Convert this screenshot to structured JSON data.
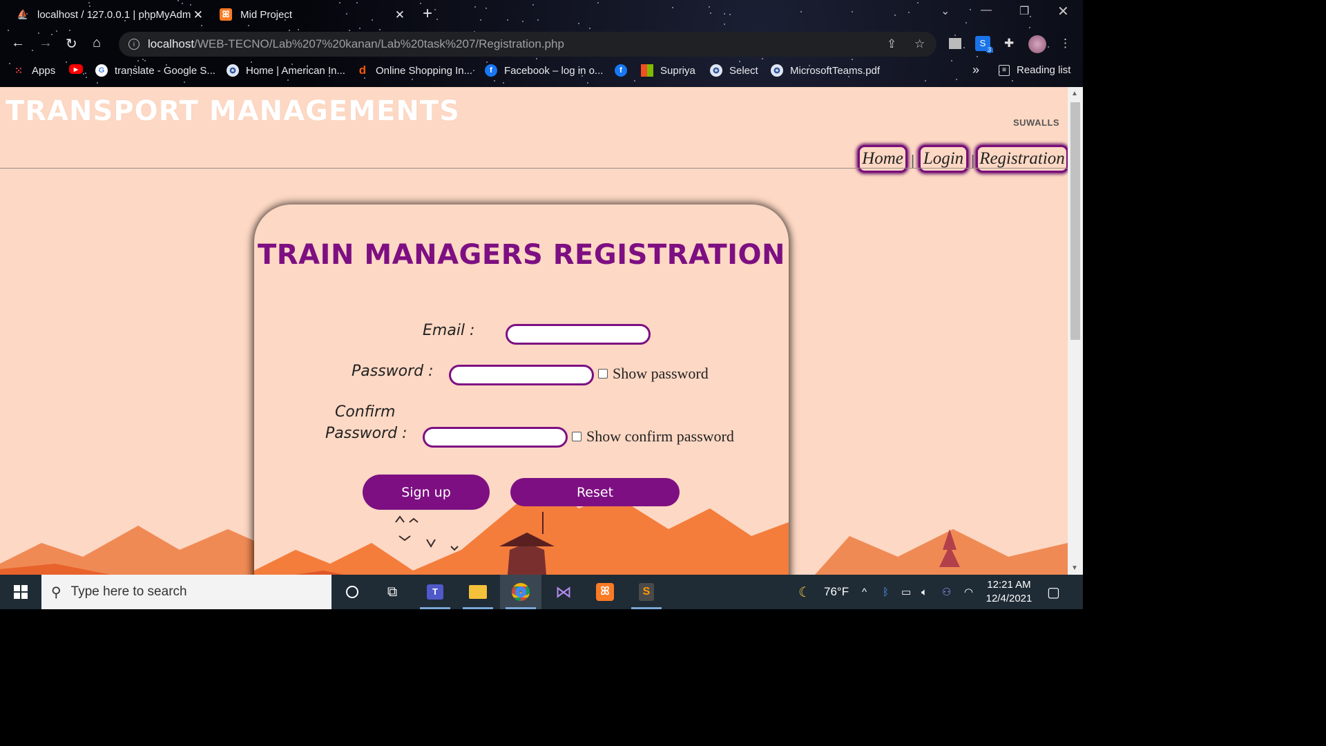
{
  "browser": {
    "tabs": [
      {
        "title": "localhost / 127.0.0.1 | phpMyAdm",
        "active": false
      },
      {
        "title": "Mid Project",
        "active": true
      }
    ],
    "url_host": "localhost",
    "url_path": "/WEB-TECNO/Lab%207%20kanan/Lab%20task%207/Registration.php",
    "extension_badge": "3",
    "bookmarks": [
      {
        "label": "Apps",
        "icon": "apps-grid-icon"
      },
      {
        "label": "",
        "icon": "youtube-icon"
      },
      {
        "label": "translate - Google S...",
        "icon": "google-icon"
      },
      {
        "label": "Home | American In...",
        "icon": "aiub-icon"
      },
      {
        "label": "Online Shopping In...",
        "icon": "daraz-icon"
      },
      {
        "label": "Facebook – log in o...",
        "icon": "facebook-icon"
      },
      {
        "label": "",
        "icon": "facebook-icon"
      },
      {
        "label": "Supriya",
        "icon": "microsoft-icon"
      },
      {
        "label": "Select",
        "icon": "aiub-icon"
      },
      {
        "label": "MicrosoftTeams.pdf",
        "icon": "aiub-icon"
      }
    ],
    "more": "»",
    "reading_list": "Reading list"
  },
  "page": {
    "site_title": "TRANSPORT MANAGEMENTS",
    "brand_small": "SUWALLS",
    "nav": [
      "Home",
      "Login",
      "Registration"
    ],
    "nav_sep": "|",
    "form": {
      "title": "TRAIN MANAGERS REGISTRATION",
      "email_label": "Email :",
      "password_label": "Password :",
      "show_password": "Show password",
      "confirm_label_1": "Confirm",
      "confirm_label_2": "Password :",
      "show_confirm": "Show confirm password",
      "signup": "Sign up",
      "reset": "Reset"
    }
  },
  "taskbar": {
    "search_placeholder": "Type here to search",
    "temperature": "76°F",
    "time": "12:21 AM",
    "date": "12/4/2021"
  },
  "colors": {
    "page_bg": "#fdd8c4",
    "accent_purple": "#7d0f82",
    "mountain_orange": "#f47d3c"
  }
}
